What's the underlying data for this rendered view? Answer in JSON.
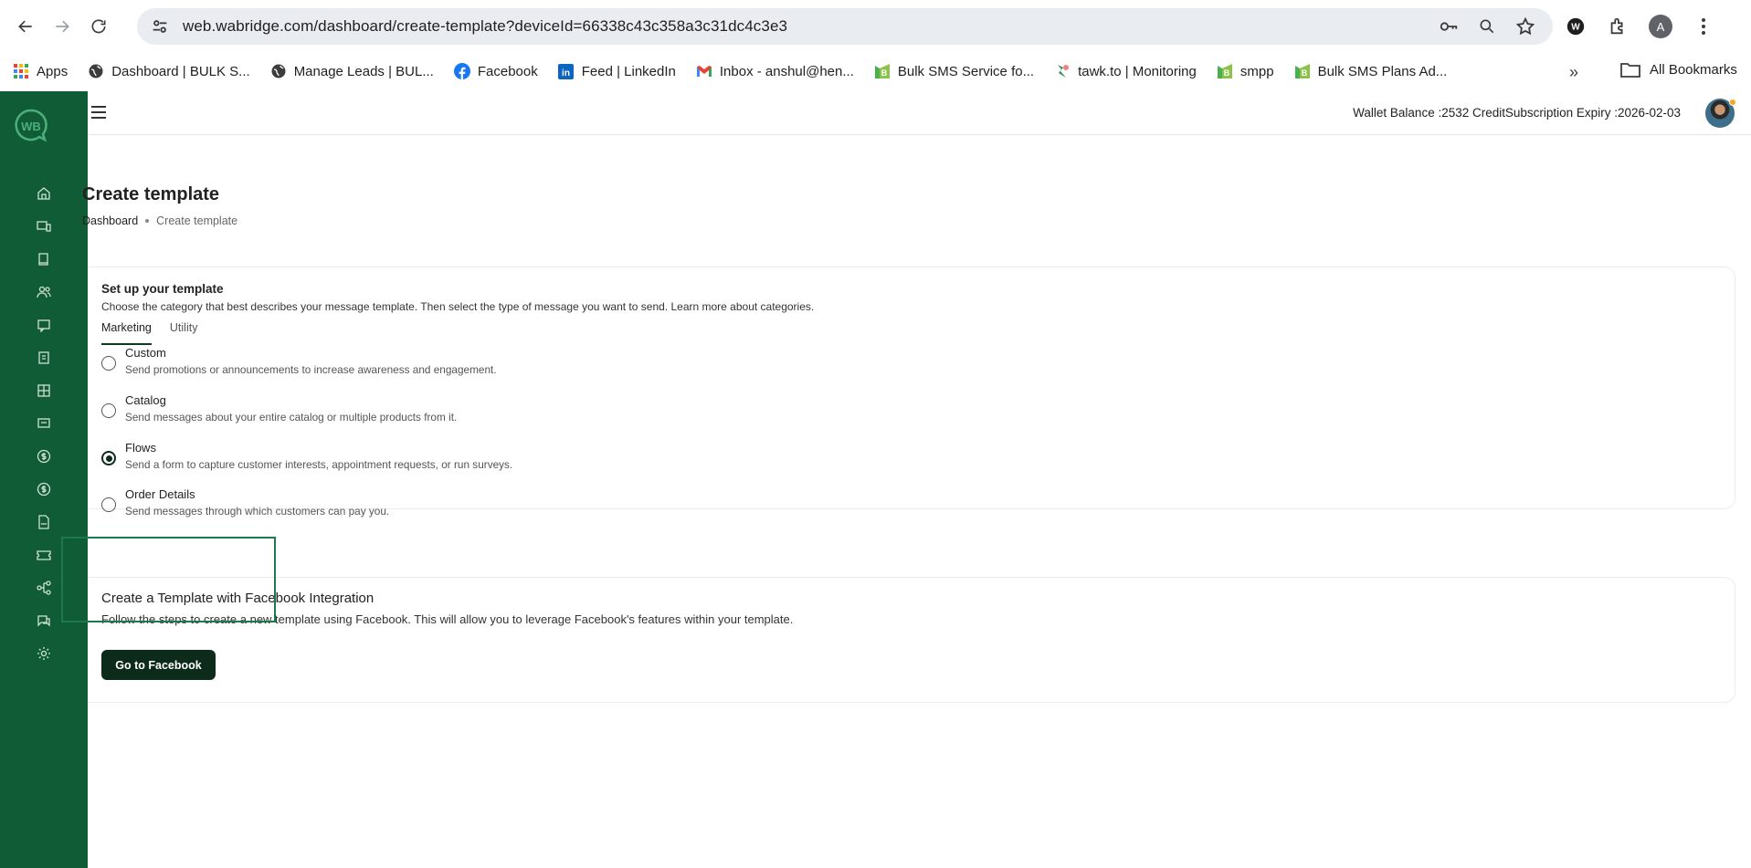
{
  "browser": {
    "url": "web.wabridge.com/dashboard/create-template?deviceId=66338c43c358a3c31dc4c3e3",
    "profile_initial": "A",
    "bookmarks": [
      {
        "label": "Apps",
        "icon": "apps-grid-icon"
      },
      {
        "label": "Dashboard | BULK S...",
        "icon": "globe-icon"
      },
      {
        "label": "Manage Leads | BUL...",
        "icon": "globe-icon"
      },
      {
        "label": "Facebook",
        "icon": "facebook-icon"
      },
      {
        "label": "Feed | LinkedIn",
        "icon": "linkedin-icon"
      },
      {
        "label": "Inbox - anshul@hen...",
        "icon": "gmail-icon"
      },
      {
        "label": "Bulk SMS Service fo...",
        "icon": "bulksms-icon"
      },
      {
        "label": "tawk.to | Monitoring",
        "icon": "tawk-icon"
      },
      {
        "label": "smpp",
        "icon": "bulksms-icon"
      },
      {
        "label": "Bulk SMS Plans Ad...",
        "icon": "bulksms-icon"
      }
    ],
    "all_bookmarks": "All Bookmarks"
  },
  "header": {
    "wallet": "Wallet Balance :2532 Credit",
    "expiry": "Subscription Expiry :2026-02-03"
  },
  "page": {
    "title": "Create template",
    "breadcrumb": [
      "Dashboard",
      "Create template"
    ]
  },
  "setup": {
    "heading": "Set up your template",
    "subtitle": "Choose the category that best describes your message template. Then select the type of message you want to send. Learn more about categories.",
    "tabs": [
      "Marketing",
      "Utility"
    ],
    "active_tab": "Marketing",
    "options": [
      {
        "title": "Custom",
        "desc": "Send promotions or announcements to increase awareness and engagement.",
        "checked": false
      },
      {
        "title": "Catalog",
        "desc": "Send messages about your entire catalog or multiple products from it.",
        "checked": false
      },
      {
        "title": "Flows",
        "desc": "Send a form to capture customer interests, appointment requests, or run surveys.",
        "checked": true
      },
      {
        "title": "Order Details",
        "desc": "Send messages through which customers can pay you.",
        "checked": false
      }
    ]
  },
  "facebook": {
    "title": "Create a Template with Facebook Integration",
    "subtitle": "Follow the steps to create a new template using Facebook. This will allow you to leverage Facebook's features within your template.",
    "button": "Go to Facebook"
  },
  "colors": {
    "sidebar": "#0f5c36",
    "primary_button": "#0d2b1a",
    "highlight": "#1a7a4c"
  }
}
